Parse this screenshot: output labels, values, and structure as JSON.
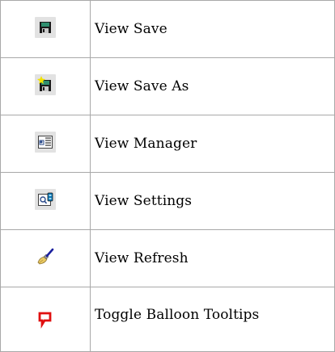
{
  "commands": [
    {
      "icon": "floppy-disk-icon",
      "label": "View Save"
    },
    {
      "icon": "floppy-disk-star-icon",
      "label": "View Save As"
    },
    {
      "icon": "view-manager-icon",
      "label": "View Manager"
    },
    {
      "icon": "view-settings-icon",
      "label": "View Settings"
    },
    {
      "icon": "paintbrush-icon",
      "label": "View Refresh"
    },
    {
      "icon": "balloon-tooltip-icon",
      "label": "Toggle Balloon Tooltips"
    }
  ],
  "colors": {
    "border": "#a8a8a8",
    "icon_background": "#e2e2e2",
    "floppy_dark": "#1a1a1a",
    "floppy_label": "#2f8f6f",
    "star_yellow": "#f2e300",
    "balloon_red": "#e01010",
    "brush_blue": "#1a1f9e",
    "brush_gold": "#e8c860"
  }
}
